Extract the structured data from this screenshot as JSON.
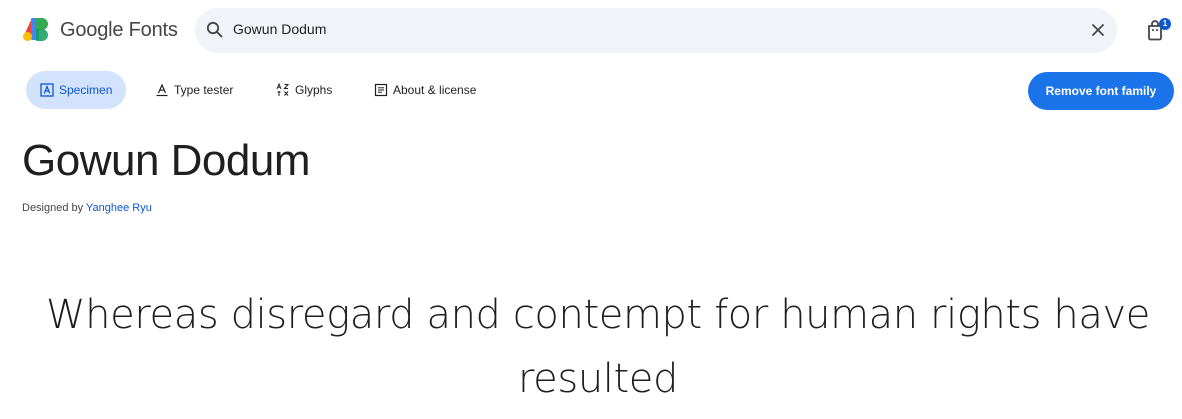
{
  "header": {
    "brand": "Google Fonts",
    "search": {
      "value": "Gowun Dodum",
      "icon": "search-icon",
      "clear_icon": "close-icon"
    },
    "cart": {
      "icon": "shopping-bag-icon",
      "count": "1"
    }
  },
  "tabs": [
    {
      "label": "Specimen",
      "icon": "specimen-icon",
      "active": true
    },
    {
      "label": "Type tester",
      "icon": "type-tester-icon",
      "active": false
    },
    {
      "label": "Glyphs",
      "icon": "glyphs-icon",
      "active": false
    },
    {
      "label": "About & license",
      "icon": "article-icon",
      "active": false
    }
  ],
  "actions": {
    "remove_label": "Remove font family"
  },
  "font": {
    "family": "Gowun Dodum",
    "designed_by_prefix": "Designed by",
    "designer": "Yanghee Ryu"
  },
  "specimen": {
    "sample_text": "Whereas disregard and contempt for human rights have resulted"
  },
  "colors": {
    "accent": "#0b57d0",
    "button": "#1a73e8",
    "active_tab_bg": "#d3e3fd",
    "search_bg": "#f0f4f9"
  }
}
